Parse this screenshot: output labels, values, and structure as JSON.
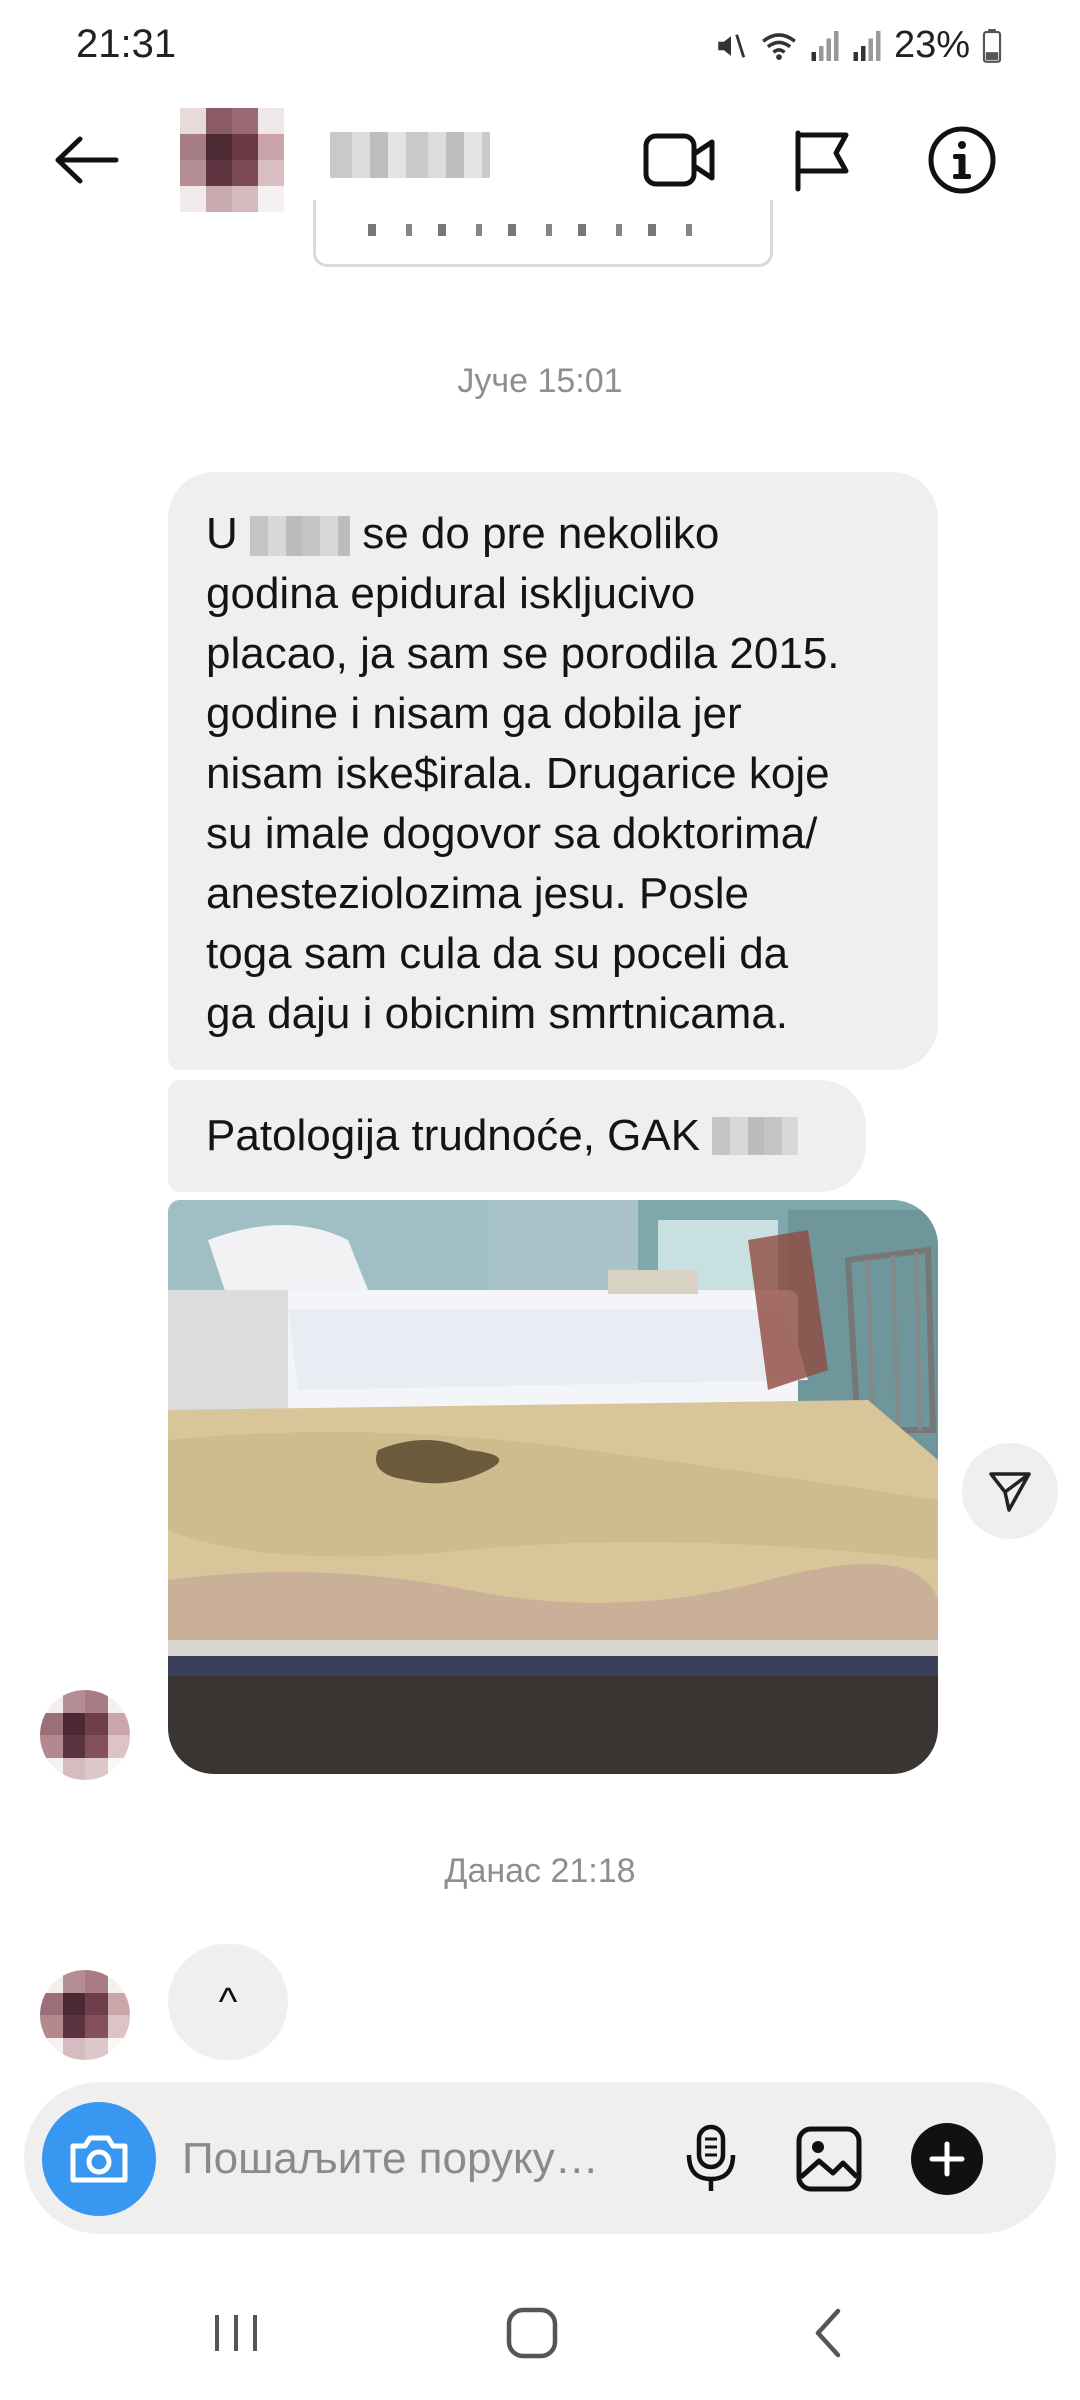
{
  "status_bar": {
    "time": "21:31",
    "battery": "23%",
    "icons": [
      "mute-icon",
      "wifi-icon",
      "signal-icon",
      "signal-icon",
      "battery-icon"
    ]
  },
  "header": {
    "back_icon": "arrow-left-icon",
    "contact_name": "",
    "actions": [
      "video-call-icon",
      "flag-icon",
      "info-icon"
    ]
  },
  "thread": {
    "timestamp_1": "Јуче 15:01",
    "message_1": {
      "lines": [
        "U ",
        " se do pre nekoliko",
        "godina epidural iskljucivo",
        "placao, ja sam se porodila 2015.",
        "godine i nisam ga dobila jer",
        "nisam iske$irala. Drugarice koje",
        "su imale dogovor sa doktorima/",
        "anesteziolozima jesu. Posle",
        "toga sam cula da su poceli da",
        "ga daju i obicnim smrtnicama."
      ]
    },
    "message_2": "Patologija trudnoće, GAK ",
    "photo_alt": "hospital room with stained mattress",
    "timestamp_2": "Данас 21:18",
    "message_3": "^"
  },
  "composer": {
    "placeholder": "Пошаљите поруку…",
    "icons": [
      "camera-icon",
      "microphone-icon",
      "gallery-icon",
      "add-icon"
    ],
    "camera_color": "#3897f0"
  },
  "nav_bar": {
    "icons": [
      "recent-apps-icon",
      "home-icon",
      "back-icon"
    ]
  }
}
